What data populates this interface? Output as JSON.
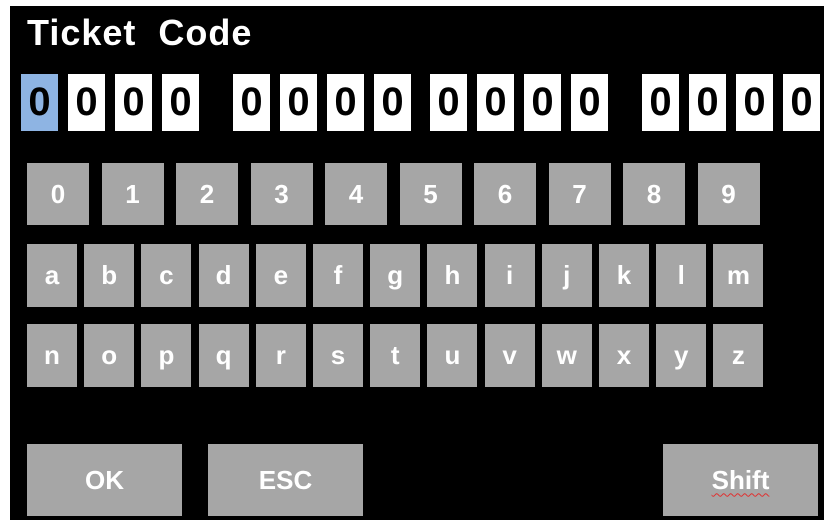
{
  "title": "Ticket  Code",
  "code": {
    "groups": [
      [
        "0",
        "0",
        "0",
        "0"
      ],
      [
        "0",
        "0",
        "0",
        "0"
      ],
      [
        "0",
        "0",
        "0",
        "0"
      ],
      [
        "0",
        "0",
        "0",
        "0"
      ]
    ],
    "cursor_index": 0
  },
  "keyboard": {
    "rows": [
      [
        "0",
        "1",
        "2",
        "3",
        "4",
        "5",
        "6",
        "7",
        "8",
        "9"
      ],
      [
        "a",
        "b",
        "c",
        "d",
        "e",
        "f",
        "g",
        "h",
        "i",
        "j",
        "k",
        "l",
        "m"
      ],
      [
        "n",
        "o",
        "p",
        "q",
        "r",
        "s",
        "t",
        "u",
        "v",
        "w",
        "x",
        "y",
        "z"
      ]
    ]
  },
  "actions": {
    "ok_label": "OK",
    "esc_label": "ESC",
    "shift_label": "Shift"
  },
  "colors": {
    "background": "#000000",
    "key": "#a6a6a6",
    "key_text": "#ffffff",
    "code_box": "#ffffff",
    "code_active": "#8eb4e3"
  }
}
